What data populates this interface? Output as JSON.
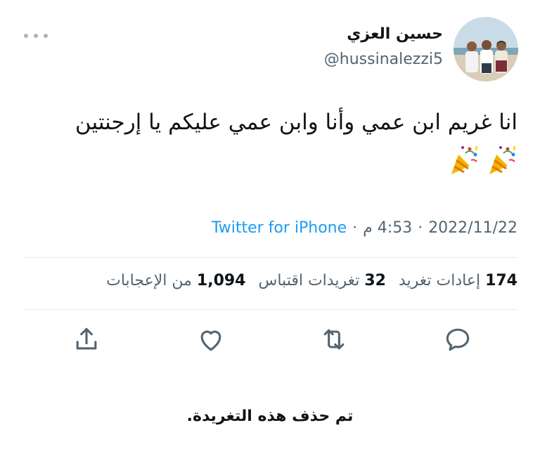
{
  "tweet": {
    "author_name": "حسين العزي",
    "author_handle": "@hussinalezzi5",
    "text": "انا غريم ابن عمي وأنا وابن عمي عليكم يا إرجنتين",
    "emojis": [
      "party-popper",
      "party-popper"
    ]
  },
  "meta": {
    "date": "2022/11/22",
    "time": "4:53 م",
    "source": "Twitter for iPhone",
    "separator": "·"
  },
  "stats": {
    "retweets_count": "174",
    "retweets_label": "إعادات تغريد",
    "quotes_count": "32",
    "quotes_label": "تغريدات اقتباس",
    "likes_count": "1,094",
    "likes_label": "من الإعجابات"
  },
  "actions": {
    "icons": [
      "reply-icon",
      "retweet-icon",
      "like-icon",
      "share-icon"
    ],
    "icon_color": "#536471"
  },
  "notice": {
    "deleted_text": "تم حذف هذه التغريدة."
  },
  "colors": {
    "link": "#1d9bf0",
    "muted": "#536471",
    "text": "#0f1419",
    "divider": "#e6ebee"
  }
}
